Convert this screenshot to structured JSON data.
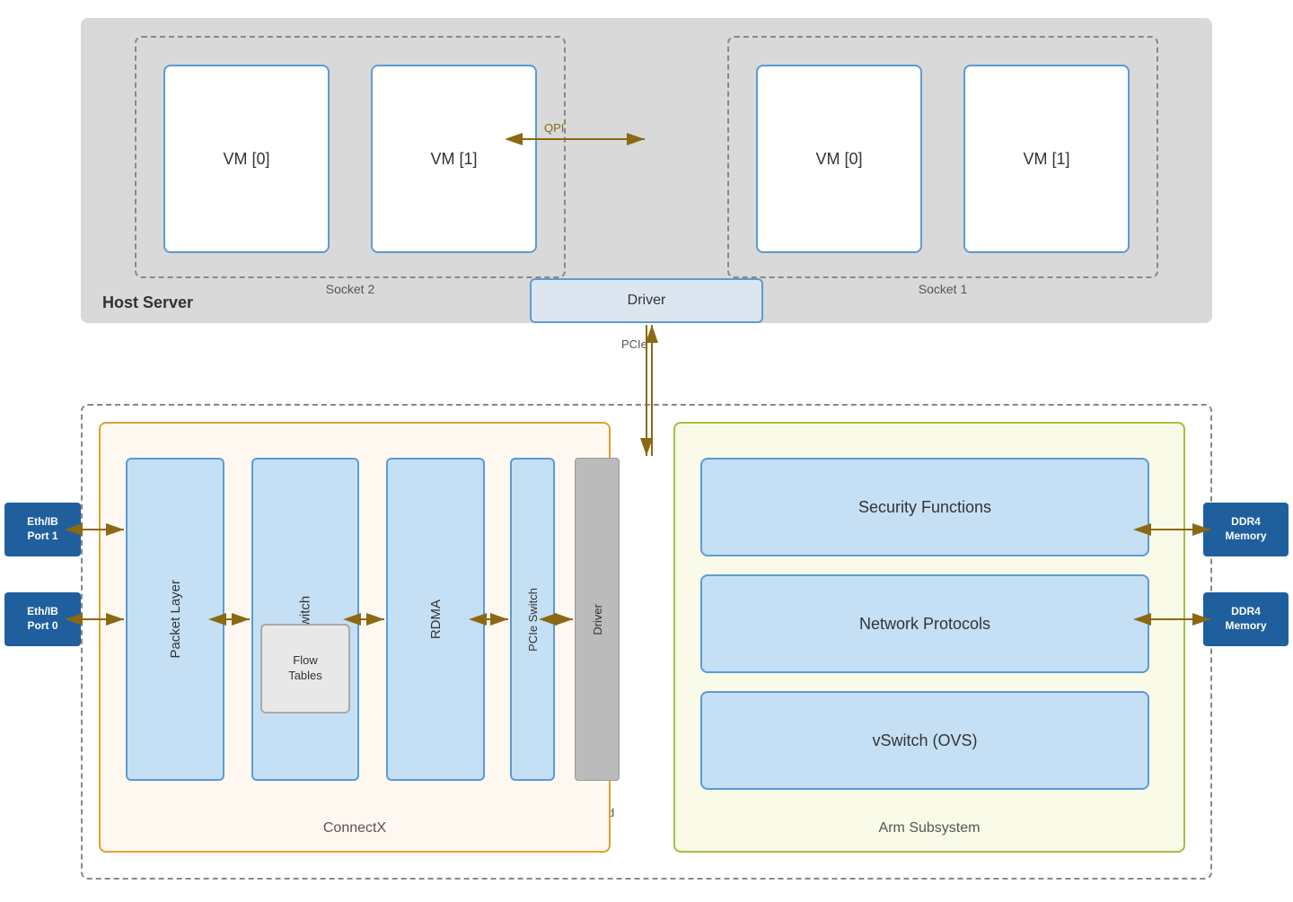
{
  "hostServer": {
    "label": "Host Server",
    "socket2": {
      "label": "Socket 2",
      "vm0": "VM [0]",
      "vm1": "VM [1]"
    },
    "socket1": {
      "label": "Socket 1",
      "vm0": "VM [0]",
      "vm1": "VM [1]"
    },
    "driver": "Driver",
    "qpi": "QPI",
    "pcie": "PCIe"
  },
  "blueField": {
    "label": "BlueField",
    "connectx": {
      "label": "ConnectX",
      "packetLayer": "Packet Layer",
      "eswitch": "eSwitch",
      "flowTables": "Flow\nTables",
      "rdma": "RDMA",
      "pcieSwitch": "PCIe Switch",
      "driver": "Driver"
    },
    "armSubsystem": {
      "label": "Arm Subsystem",
      "securityFunctions": "Security Functions",
      "networkProtocols": "Network Protocols",
      "vswitch": "vSwitch (OVS)"
    },
    "ports": {
      "port1": "Eth/IB\nPort 1",
      "port0": "Eth/IB\nPort 0"
    },
    "memory": {
      "ddr4top": "DDR4\nMemory",
      "ddr4bot": "DDR4\nMemory"
    }
  },
  "colors": {
    "arrowColor": "#8a6914",
    "driverBoxBg": "#dce6f1",
    "vmBorder": "#5b9bd5",
    "componentBg": "#c5e0f5",
    "componentBorder": "#5b9bd5",
    "connectxBorder": "#e0a030",
    "armBorder": "#9dc33c",
    "portBg": "#1f5f9e",
    "driverGray": "#bbb"
  }
}
